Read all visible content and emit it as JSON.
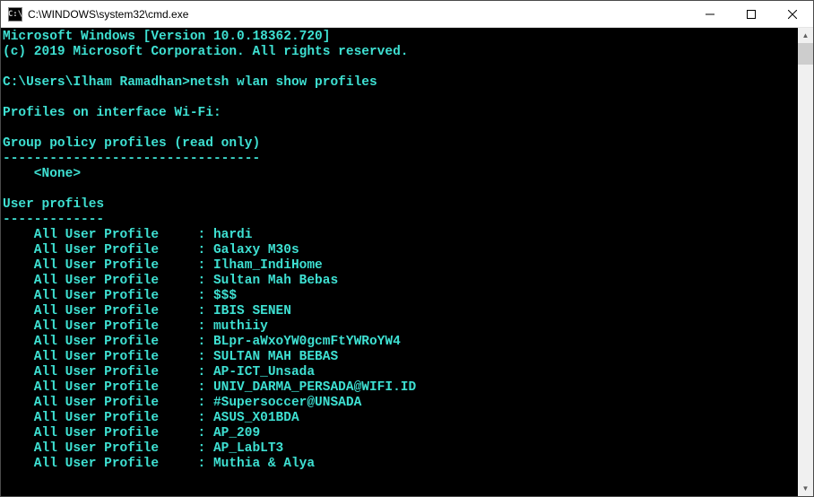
{
  "titlebar": {
    "icon_label": "C:\\",
    "title": "C:\\WINDOWS\\system32\\cmd.exe"
  },
  "console": {
    "header_line1": "Microsoft Windows [Version 10.0.18362.720]",
    "header_line2": "(c) 2019 Microsoft Corporation. All rights reserved.",
    "prompt": "C:\\Users\\Ilham Ramadhan>",
    "command": "netsh wlan show profiles",
    "section_interface": "Profiles on interface Wi-Fi:",
    "section_group": "Group policy profiles (read only)",
    "dashes_group": "---------------------------------",
    "none_entry": "    <None>",
    "section_user": "User profiles",
    "dashes_user": "-------------",
    "profile_label": "    All User Profile     : ",
    "profiles": [
      "hardi",
      "Galaxy M30s",
      "Ilham_IndiHome",
      "Sultan Mah Bebas",
      "$$$",
      "IBIS SENEN",
      "muthiiy",
      "BLpr-aWxoYW0gcmFtYWRoYW4",
      "SULTAN MAH BEBAS",
      "AP-ICT_Unsada",
      "UNIV_DARMA_PERSADA@WIFI.ID",
      "#Supersoccer@UNSADA",
      "ASUS_X01BDA",
      "AP_209",
      "AP_LabLT3",
      "Muthia & Alya"
    ]
  }
}
